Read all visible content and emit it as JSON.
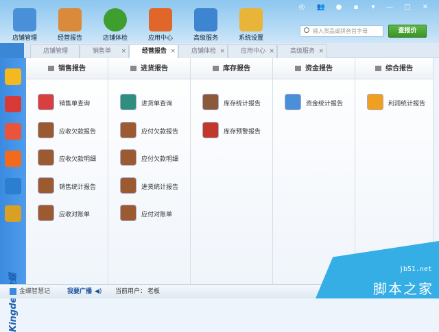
{
  "header": {
    "nav": [
      {
        "label": "店铺管理",
        "icon": "store-icon",
        "color": "#4a90d8"
      },
      {
        "label": "经营报告",
        "icon": "clipboard-chart-icon",
        "color": "#d98a3a"
      },
      {
        "label": "店铺体检",
        "icon": "home-check-icon",
        "color": "#3e9e2e"
      },
      {
        "label": "应用中心",
        "icon": "app-center-icon",
        "color": "#e0662a"
      },
      {
        "label": "高级服务",
        "icon": "cloud-icon",
        "color": "#3d85d0"
      },
      {
        "label": "系统设置",
        "icon": "gear-folder-icon",
        "color": "#e8b43a"
      }
    ],
    "search_placeholder": "输入货品或拼音首字母",
    "search_button": "查报价"
  },
  "tabs": [
    {
      "label": "店铺管理",
      "closable": false
    },
    {
      "label": "销售单",
      "closable": true
    },
    {
      "label": "经营报告",
      "closable": true,
      "active": true
    },
    {
      "label": "店铺体检",
      "closable": true
    },
    {
      "label": "应用中心",
      "closable": true
    },
    {
      "label": "高级服务",
      "closable": true
    }
  ],
  "sidebar": {
    "icons": [
      "boxes-icon",
      "calendar-icon",
      "contacts-icon",
      "taobao-icon",
      "mobile-icon",
      "notebook-icon"
    ],
    "brand": "Kingdee金蝶"
  },
  "columns": [
    {
      "title": "销售报告",
      "items": [
        "销售单查询",
        "应收欠款报告",
        "应收欠款明细",
        "销售统计报告",
        "应收对账单"
      ]
    },
    {
      "title": "进货报告",
      "items": [
        "进货单查询",
        "应付欠款报告",
        "应付欠款明细",
        "进货统计报告",
        "应付对账单"
      ]
    },
    {
      "title": "库存报告",
      "items": [
        "库存统计报告",
        "库存预警报告"
      ]
    },
    {
      "title": "资金报告",
      "items": [
        "资金统计报告"
      ]
    },
    {
      "title": "综合报告",
      "items": [
        "利润统计报告"
      ]
    }
  ],
  "status": {
    "app": "金蝶智慧记",
    "broadcast": "我要广播",
    "user_label": "当前用户：",
    "user": "老板"
  },
  "watermark": {
    "site": "jb51.net",
    "name": "脚本之家"
  }
}
